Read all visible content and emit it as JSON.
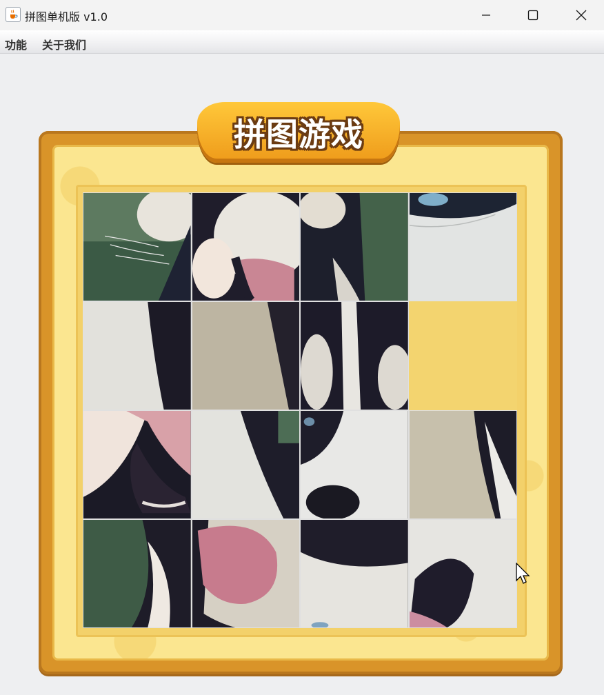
{
  "window": {
    "title": "拼图单机版 v1.0",
    "icon": "java-cup-icon",
    "controls": [
      "minimize-icon",
      "maximize-icon",
      "close-icon"
    ]
  },
  "menu": {
    "items": [
      "功能",
      "关于我们"
    ]
  },
  "game": {
    "banner_title": "拼图游戏",
    "grid_size": 4,
    "empty_tile": {
      "row": 2,
      "col": 4
    },
    "colors": {
      "frame": "#d99429",
      "board_bg": "#fbe690",
      "empty_tile": "#f3d46f",
      "banner": "#f5b028"
    }
  }
}
